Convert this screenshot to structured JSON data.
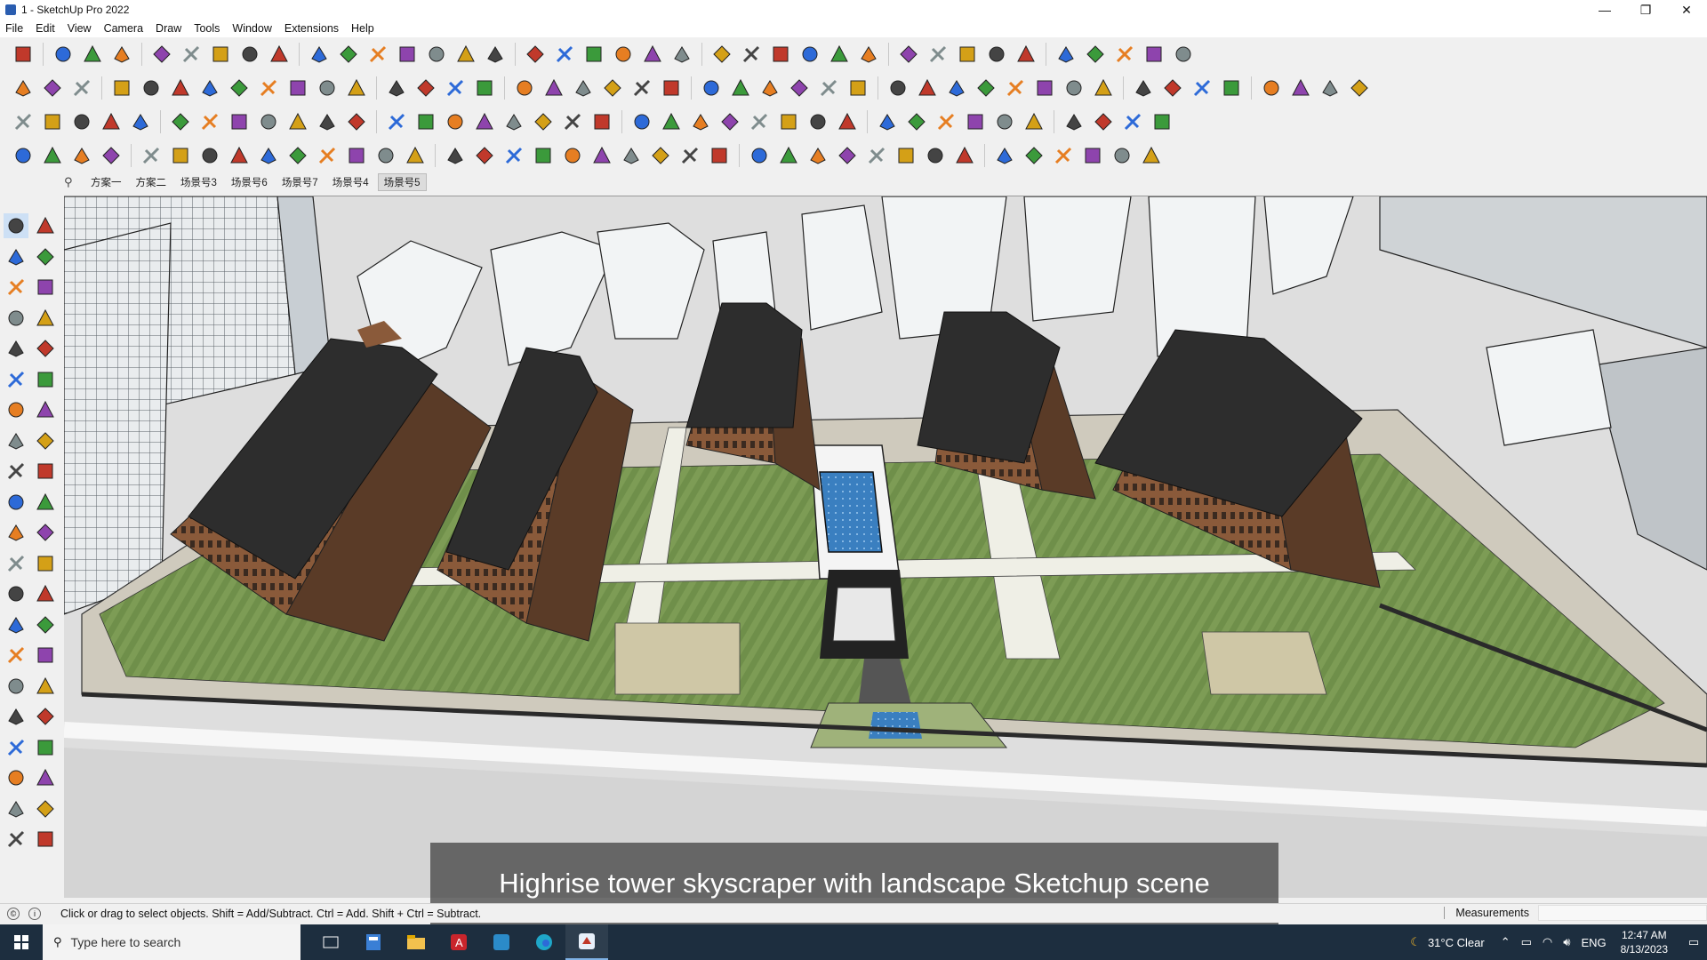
{
  "window": {
    "title": "1 - SketchUp Pro 2022",
    "controls": {
      "minimize": "—",
      "restore": "❐",
      "close": "✕"
    }
  },
  "menu": [
    "File",
    "Edit",
    "View",
    "Camera",
    "Draw",
    "Tools",
    "Window",
    "Extensions",
    "Help"
  ],
  "scene_tabs": [
    "方案一",
    "方案二",
    "场景号3",
    "场景号6",
    "场景号7",
    "场景号4",
    "场景号5"
  ],
  "active_scene_tab": "场景号5",
  "caption": "Highrise tower skyscraper with landscape Sketchup scene",
  "statusbar": {
    "message": "Click or drag to select objects. Shift = Add/Subtract. Ctrl = Add. Shift + Ctrl = Subtract.",
    "measurements_label": "Measurements",
    "measurements_value": ""
  },
  "taskbar": {
    "search_placeholder": "Type here to search",
    "weather": "31°C  Clear",
    "language": "ENG",
    "time": "12:47 AM",
    "date": "8/13/2023"
  },
  "colors": {
    "roof": "#2d2d2d",
    "facade": "#8a5a3a",
    "lawn": "#6f8f4a",
    "water": "#3a7fc0",
    "road": "#c9c9c9",
    "context_building": "#f2f4f5",
    "taskbar": "#1d2e3f",
    "accent": "#4a90d9"
  }
}
